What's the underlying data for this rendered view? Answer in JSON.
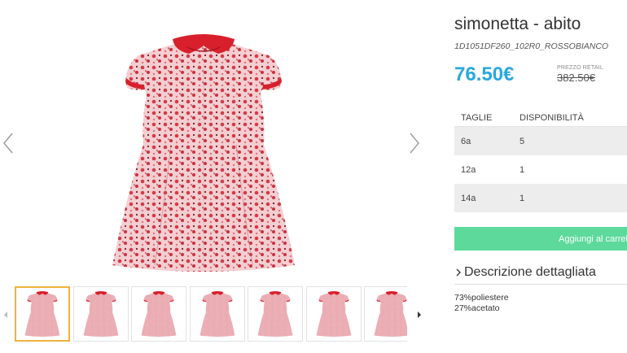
{
  "product": {
    "title": "simonetta - abito",
    "sku": "1D1051DF260_102R0_ROSSOBIANCO",
    "price": "76.50€",
    "retail_label": "PREZZO RETAIL",
    "retail_price": "382.50€"
  },
  "sizes": {
    "headers": [
      "TAGLIE",
      "DISPONIBILITÀ"
    ],
    "rows": [
      {
        "size": "6a",
        "availability": "5"
      },
      {
        "size": "12a",
        "availability": "1"
      },
      {
        "size": "14a",
        "availability": "1"
      }
    ]
  },
  "cart_button": {
    "label": "Aggiungi al carrello"
  },
  "description": {
    "title": "Descrizione dettagliata",
    "lines": [
      "73%poliestere",
      "27%acetato"
    ]
  },
  "gallery": {
    "thumbnail_count": 7,
    "active_thumbnail": 0
  },
  "colors": {
    "price": "#29a8e0",
    "cart_button": "#5cd99b",
    "active_thumb_border": "#f0b23c",
    "dress_fabric": "#e07e84",
    "dress_collar": "#d8202d"
  },
  "icons": {
    "prev": "chevron-left-icon",
    "next": "chevron-right-icon",
    "thumb_prev": "caret-left-icon",
    "thumb_next": "caret-right-icon",
    "description_toggle": "chevron-right-icon"
  }
}
